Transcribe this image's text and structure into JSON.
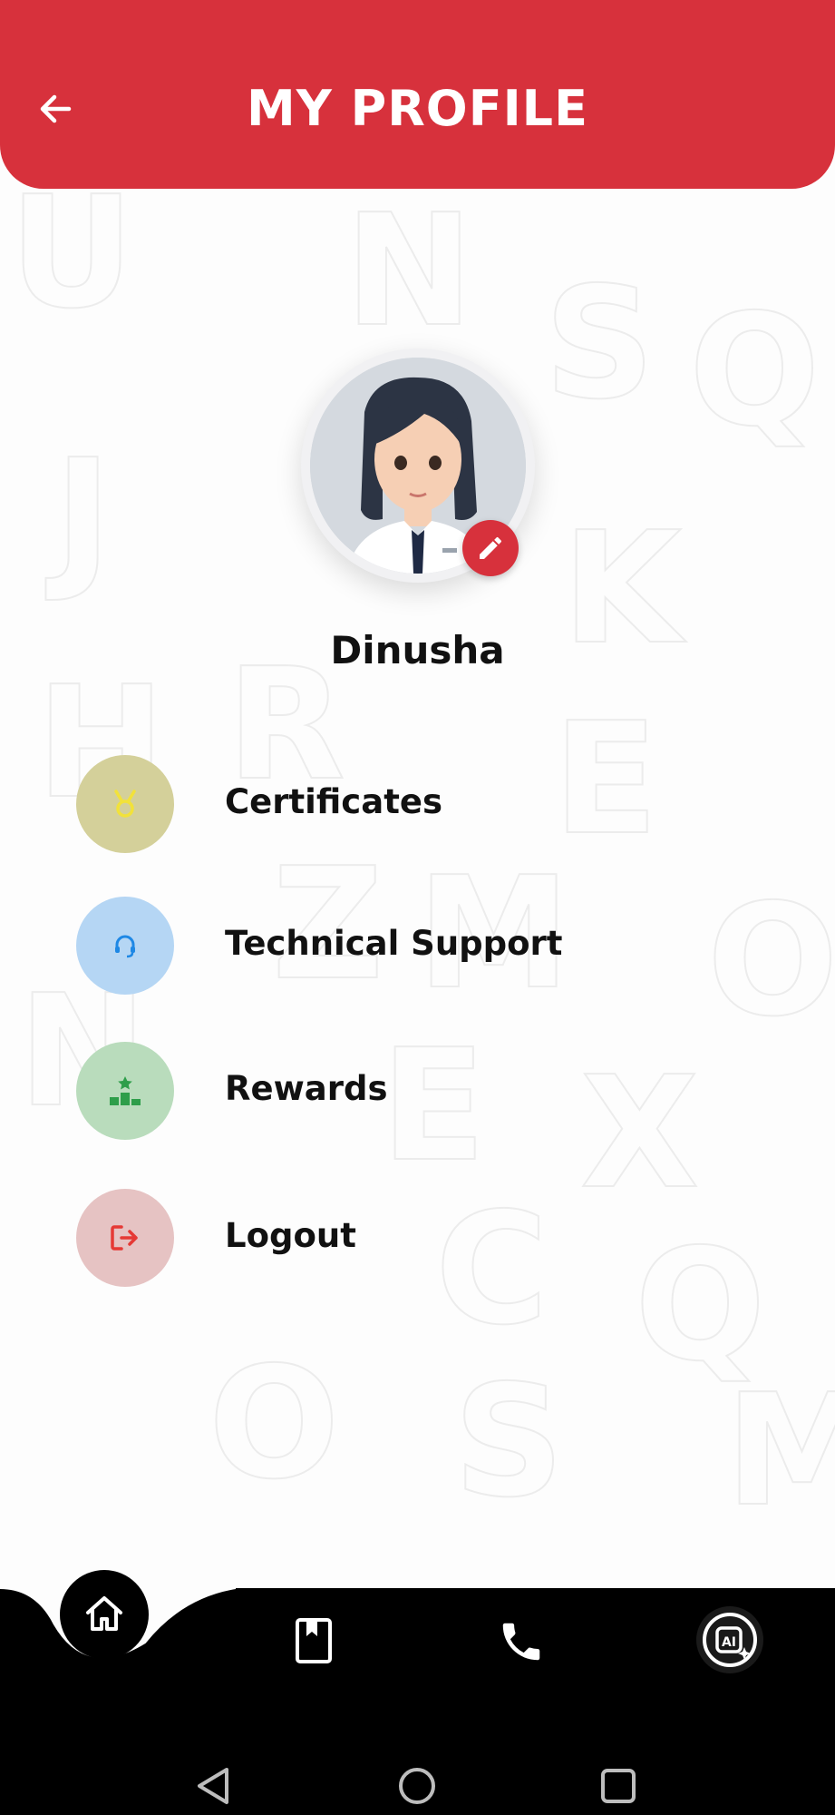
{
  "header": {
    "title": "MY PROFILE"
  },
  "profile": {
    "name": "Dinusha"
  },
  "menu": [
    {
      "label": "Certificates",
      "bg": "#d4d09a",
      "icon": "medal-icon"
    },
    {
      "label": "Technical Support",
      "bg": "#b5d6f4",
      "icon": "headset-icon"
    },
    {
      "label": "Rewards",
      "bg": "#b9dcbc",
      "icon": "podium-icon"
    },
    {
      "label": "Logout",
      "bg": "#e6c3c3",
      "icon": "logout-icon"
    }
  ],
  "bottom_nav": [
    "home-icon",
    "book-icon",
    "phone-icon",
    "ai-assistant-icon"
  ],
  "colors": {
    "accent": "#d7313c"
  }
}
